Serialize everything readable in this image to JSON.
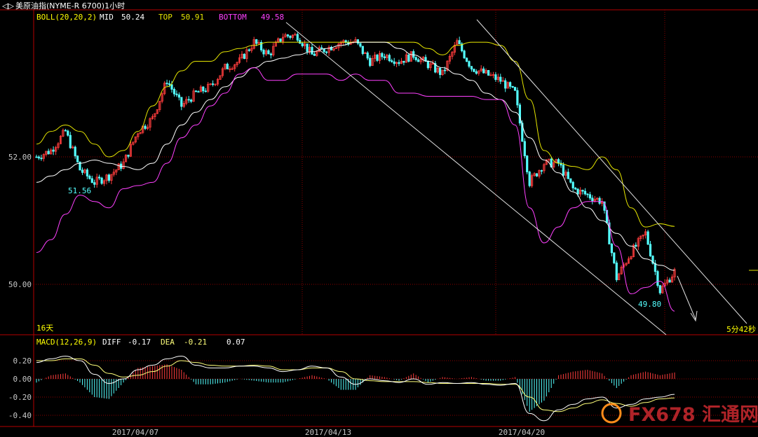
{
  "header": {
    "nav_icon": "back-forward-arrows-icon",
    "title": "美原油指(NYME-R 6700)1小时"
  },
  "boll_legend": {
    "name": "BOLL(20,20,2)",
    "mid_label": "MID",
    "mid_value": "50.24",
    "top_label": "TOP",
    "top_value": "50.91",
    "bottom_label": "BOTTOM",
    "bottom_value": "49.58"
  },
  "macd_legend": {
    "name": "MACD(12,26,9)",
    "diff_label": "DIFF",
    "diff_value": "-0.17",
    "dea_label": "DEA",
    "dea_value": "-0.21",
    "macd_value": "0.07"
  },
  "period_label": "16天",
  "countdown": "5分42秒",
  "watermark": "FX678 汇通网",
  "colors": {
    "up": "#ff3c3c",
    "down": "#54ffff",
    "mid": "#ffffff",
    "top": "#e6e600",
    "bottom": "#ff40ff",
    "diff": "#ffffff",
    "dea": "#ffff7a",
    "grid": "#8b0000",
    "axis_text": "#c8c8c8",
    "annotation": "#54ffff",
    "boll_name": "#ffff00"
  },
  "chart_data": [
    {
      "type": "candlestick",
      "title": "美原油指(NYME-R 6700)1小时",
      "ylim": [
        49.2,
        53.8
      ],
      "yticks": [
        "52.00",
        "50.00"
      ],
      "xlabels": [
        "2017/04/07",
        "2017/04/13",
        "2017/04/20"
      ],
      "series": [
        {
          "name": "MID",
          "values": [
            51.6,
            51.7,
            51.8,
            51.9,
            51.95,
            51.9,
            51.85,
            51.8,
            51.9,
            52.2,
            52.5,
            52.7,
            52.9,
            53.1,
            53.25,
            53.4,
            53.5,
            53.55,
            53.6,
            53.65,
            53.7,
            53.75,
            53.8,
            53.8,
            53.8,
            53.7,
            53.6,
            53.5,
            53.4,
            53.3,
            53.2,
            53.0,
            52.9,
            52.7,
            52.3,
            51.95,
            51.75,
            51.45,
            51.2,
            51.0,
            50.8,
            50.6,
            50.4,
            50.3,
            50.22
          ]
        },
        {
          "name": "TOP",
          "values": [
            52.2,
            52.4,
            52.5,
            52.4,
            52.2,
            52.0,
            52.1,
            52.4,
            52.8,
            53.1,
            53.35,
            53.5,
            53.5,
            53.65,
            53.7,
            53.75,
            53.8,
            53.8,
            53.8,
            53.8,
            53.8,
            53.8,
            53.8,
            53.8,
            53.8,
            53.8,
            53.8,
            53.7,
            53.6,
            53.75,
            53.8,
            53.8,
            53.75,
            53.5,
            52.9,
            52.1,
            51.9,
            51.85,
            51.8,
            52.0,
            51.8,
            51.2,
            50.9,
            50.95,
            50.91
          ]
        },
        {
          "name": "BOTTOM",
          "values": [
            50.5,
            50.7,
            51.1,
            51.4,
            51.3,
            51.2,
            51.5,
            51.55,
            51.6,
            51.9,
            52.3,
            52.5,
            52.8,
            53.0,
            53.3,
            53.4,
            53.2,
            53.2,
            53.3,
            53.3,
            53.3,
            53.2,
            53.3,
            53.2,
            53.2,
            53.0,
            53.0,
            52.95,
            52.95,
            52.95,
            52.95,
            52.9,
            52.9,
            52.5,
            51.2,
            50.65,
            50.9,
            51.2,
            51.3,
            51.3,
            50.6,
            49.85,
            49.95,
            50.05,
            49.58
          ]
        },
        {
          "name": "K",
          "values": [
            52.0,
            52.1,
            52.4,
            51.8,
            51.6,
            51.7,
            51.9,
            52.4,
            52.6,
            53.2,
            52.8,
            53.0,
            53.1,
            53.4,
            53.5,
            53.8,
            53.6,
            53.9,
            53.9,
            53.6,
            53.7,
            53.8,
            53.8,
            53.5,
            53.6,
            53.5,
            53.6,
            53.45,
            53.3,
            53.8,
            53.4,
            53.3,
            53.2,
            53.0,
            51.6,
            51.9,
            51.9,
            51.5,
            51.4,
            51.3,
            50.1,
            50.5,
            50.8,
            49.9,
            50.2
          ]
        }
      ]
    },
    {
      "type": "bar",
      "title": "MACD(12,26,9)",
      "ylim": [
        -0.5,
        0.3
      ],
      "yticks": [
        "0.20",
        "0.00",
        "-0.20",
        "-0.40"
      ],
      "series": [
        {
          "name": "DIFF",
          "values": [
            0.18,
            0.22,
            0.25,
            0.2,
            0.05,
            -0.05,
            0.0,
            0.1,
            0.15,
            0.22,
            0.25,
            0.15,
            0.12,
            0.12,
            0.14,
            0.14,
            0.12,
            0.08,
            0.1,
            0.14,
            0.12,
            0.02,
            -0.06,
            0.0,
            -0.02,
            -0.04,
            0.0,
            -0.06,
            -0.04,
            -0.05,
            -0.04,
            -0.06,
            -0.07,
            -0.05,
            -0.38,
            -0.46,
            -0.34,
            -0.28,
            -0.22,
            -0.2,
            -0.32,
            -0.28,
            -0.22,
            -0.2,
            -0.17
          ]
        },
        {
          "name": "DEA",
          "values": [
            0.2,
            0.2,
            0.22,
            0.22,
            0.15,
            0.06,
            0.02,
            0.04,
            0.08,
            0.14,
            0.2,
            0.18,
            0.15,
            0.14,
            0.14,
            0.15,
            0.14,
            0.1,
            0.1,
            0.12,
            0.12,
            0.08,
            0.0,
            -0.02,
            -0.03,
            -0.03,
            -0.03,
            -0.04,
            -0.05,
            -0.05,
            -0.05,
            -0.05,
            -0.06,
            -0.06,
            -0.2,
            -0.34,
            -0.36,
            -0.32,
            -0.27,
            -0.23,
            -0.27,
            -0.3,
            -0.26,
            -0.22,
            -0.21
          ]
        },
        {
          "name": "MACD",
          "values": [
            -0.04,
            0.04,
            0.06,
            -0.04,
            -0.2,
            -0.22,
            -0.04,
            0.12,
            0.14,
            0.16,
            0.1,
            -0.06,
            -0.06,
            -0.04,
            0.0,
            -0.02,
            -0.04,
            -0.04,
            0.0,
            0.04,
            0.0,
            -0.12,
            -0.12,
            0.04,
            0.02,
            -0.02,
            0.06,
            -0.04,
            0.02,
            0.0,
            0.02,
            -0.02,
            -0.02,
            0.02,
            -0.36,
            -0.24,
            0.04,
            0.08,
            0.1,
            0.06,
            -0.1,
            0.04,
            0.08,
            0.04,
            0.07
          ]
        }
      ]
    }
  ],
  "annotations": [
    {
      "name": "low-marker-1",
      "text": "51.56"
    },
    {
      "name": "low-marker-2",
      "text": "49.80"
    }
  ]
}
